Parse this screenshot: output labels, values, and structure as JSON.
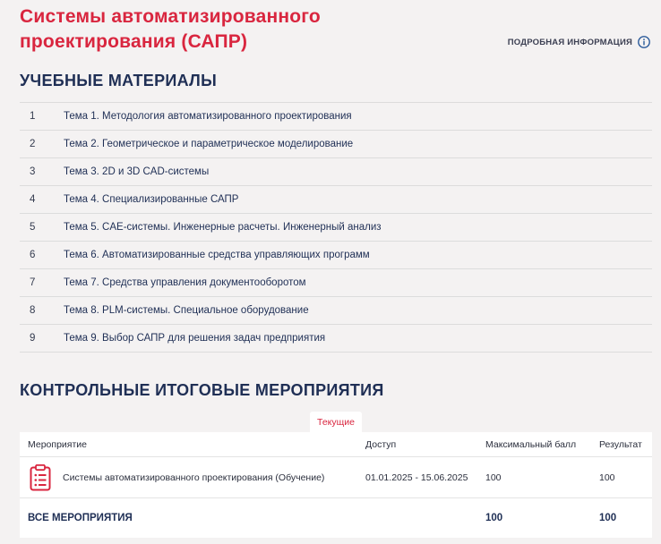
{
  "course": {
    "title": "Системы автоматизированного проектирования (САПР)",
    "more_info_label": "ПОДРОБНАЯ ИНФОРМАЦИЯ"
  },
  "materials": {
    "heading": "УЧЕБНЫЕ МАТЕРИАЛЫ",
    "items": [
      {
        "num": "1",
        "label": "Тема 1. Методология автоматизированного проектирования"
      },
      {
        "num": "2",
        "label": "Тема 2. Геометрическое и параметрическое моделирование"
      },
      {
        "num": "3",
        "label": "Тема 3. 2D и 3D CAD-системы"
      },
      {
        "num": "4",
        "label": "Тема 4. Специализированные САПР"
      },
      {
        "num": "5",
        "label": "Тема 5. CAE-системы. Инженерные расчеты. Инженерный анализ"
      },
      {
        "num": "6",
        "label": "Тема 6. Автоматизированные средства управляющих программ"
      },
      {
        "num": "7",
        "label": "Тема 7. Средства управления документооборотом"
      },
      {
        "num": "8",
        "label": "Тема 8. PLM-системы. Специальное оборудование"
      },
      {
        "num": "9",
        "label": "Тема 9. Выбор САПР для решения задач предприятия"
      }
    ]
  },
  "events": {
    "heading": "КОНТРОЛЬНЫЕ ИТОГОВЫЕ МЕРОПРИЯТИЯ",
    "tab_current": "Текущие",
    "columns": {
      "event": "Мероприятие",
      "access": "Доступ",
      "max_score": "Максимальный балл",
      "result": "Результат"
    },
    "rows": [
      {
        "icon": "clipboard-list-icon",
        "name": "Системы автоматизированного проектирования (Обучение)",
        "access": "01.01.2025 - 15.06.2025",
        "max_score": "100",
        "result": "100"
      }
    ],
    "total": {
      "label": "ВСЕ МЕРОПРИЯТИЯ",
      "max_score": "100",
      "result": "100"
    }
  },
  "colors": {
    "accent": "#d9263f",
    "heading": "#1f2f55",
    "background": "#f4f2f2",
    "info_icon": "#2a5a9a"
  }
}
